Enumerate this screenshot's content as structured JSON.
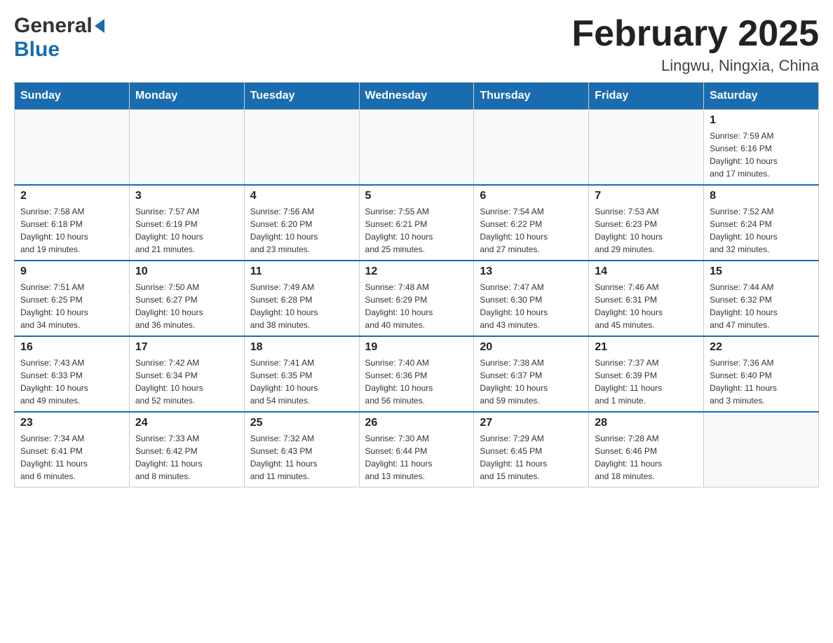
{
  "header": {
    "logo_general": "General",
    "logo_blue": "Blue",
    "month_title": "February 2025",
    "location": "Lingwu, Ningxia, China"
  },
  "weekdays": [
    "Sunday",
    "Monday",
    "Tuesday",
    "Wednesday",
    "Thursday",
    "Friday",
    "Saturday"
  ],
  "weeks": [
    [
      {
        "day": "",
        "info": ""
      },
      {
        "day": "",
        "info": ""
      },
      {
        "day": "",
        "info": ""
      },
      {
        "day": "",
        "info": ""
      },
      {
        "day": "",
        "info": ""
      },
      {
        "day": "",
        "info": ""
      },
      {
        "day": "1",
        "info": "Sunrise: 7:59 AM\nSunset: 6:16 PM\nDaylight: 10 hours\nand 17 minutes."
      }
    ],
    [
      {
        "day": "2",
        "info": "Sunrise: 7:58 AM\nSunset: 6:18 PM\nDaylight: 10 hours\nand 19 minutes."
      },
      {
        "day": "3",
        "info": "Sunrise: 7:57 AM\nSunset: 6:19 PM\nDaylight: 10 hours\nand 21 minutes."
      },
      {
        "day": "4",
        "info": "Sunrise: 7:56 AM\nSunset: 6:20 PM\nDaylight: 10 hours\nand 23 minutes."
      },
      {
        "day": "5",
        "info": "Sunrise: 7:55 AM\nSunset: 6:21 PM\nDaylight: 10 hours\nand 25 minutes."
      },
      {
        "day": "6",
        "info": "Sunrise: 7:54 AM\nSunset: 6:22 PM\nDaylight: 10 hours\nand 27 minutes."
      },
      {
        "day": "7",
        "info": "Sunrise: 7:53 AM\nSunset: 6:23 PM\nDaylight: 10 hours\nand 29 minutes."
      },
      {
        "day": "8",
        "info": "Sunrise: 7:52 AM\nSunset: 6:24 PM\nDaylight: 10 hours\nand 32 minutes."
      }
    ],
    [
      {
        "day": "9",
        "info": "Sunrise: 7:51 AM\nSunset: 6:25 PM\nDaylight: 10 hours\nand 34 minutes."
      },
      {
        "day": "10",
        "info": "Sunrise: 7:50 AM\nSunset: 6:27 PM\nDaylight: 10 hours\nand 36 minutes."
      },
      {
        "day": "11",
        "info": "Sunrise: 7:49 AM\nSunset: 6:28 PM\nDaylight: 10 hours\nand 38 minutes."
      },
      {
        "day": "12",
        "info": "Sunrise: 7:48 AM\nSunset: 6:29 PM\nDaylight: 10 hours\nand 40 minutes."
      },
      {
        "day": "13",
        "info": "Sunrise: 7:47 AM\nSunset: 6:30 PM\nDaylight: 10 hours\nand 43 minutes."
      },
      {
        "day": "14",
        "info": "Sunrise: 7:46 AM\nSunset: 6:31 PM\nDaylight: 10 hours\nand 45 minutes."
      },
      {
        "day": "15",
        "info": "Sunrise: 7:44 AM\nSunset: 6:32 PM\nDaylight: 10 hours\nand 47 minutes."
      }
    ],
    [
      {
        "day": "16",
        "info": "Sunrise: 7:43 AM\nSunset: 6:33 PM\nDaylight: 10 hours\nand 49 minutes."
      },
      {
        "day": "17",
        "info": "Sunrise: 7:42 AM\nSunset: 6:34 PM\nDaylight: 10 hours\nand 52 minutes."
      },
      {
        "day": "18",
        "info": "Sunrise: 7:41 AM\nSunset: 6:35 PM\nDaylight: 10 hours\nand 54 minutes."
      },
      {
        "day": "19",
        "info": "Sunrise: 7:40 AM\nSunset: 6:36 PM\nDaylight: 10 hours\nand 56 minutes."
      },
      {
        "day": "20",
        "info": "Sunrise: 7:38 AM\nSunset: 6:37 PM\nDaylight: 10 hours\nand 59 minutes."
      },
      {
        "day": "21",
        "info": "Sunrise: 7:37 AM\nSunset: 6:39 PM\nDaylight: 11 hours\nand 1 minute."
      },
      {
        "day": "22",
        "info": "Sunrise: 7:36 AM\nSunset: 6:40 PM\nDaylight: 11 hours\nand 3 minutes."
      }
    ],
    [
      {
        "day": "23",
        "info": "Sunrise: 7:34 AM\nSunset: 6:41 PM\nDaylight: 11 hours\nand 6 minutes."
      },
      {
        "day": "24",
        "info": "Sunrise: 7:33 AM\nSunset: 6:42 PM\nDaylight: 11 hours\nand 8 minutes."
      },
      {
        "day": "25",
        "info": "Sunrise: 7:32 AM\nSunset: 6:43 PM\nDaylight: 11 hours\nand 11 minutes."
      },
      {
        "day": "26",
        "info": "Sunrise: 7:30 AM\nSunset: 6:44 PM\nDaylight: 11 hours\nand 13 minutes."
      },
      {
        "day": "27",
        "info": "Sunrise: 7:29 AM\nSunset: 6:45 PM\nDaylight: 11 hours\nand 15 minutes."
      },
      {
        "day": "28",
        "info": "Sunrise: 7:28 AM\nSunset: 6:46 PM\nDaylight: 11 hours\nand 18 minutes."
      },
      {
        "day": "",
        "info": ""
      }
    ]
  ]
}
